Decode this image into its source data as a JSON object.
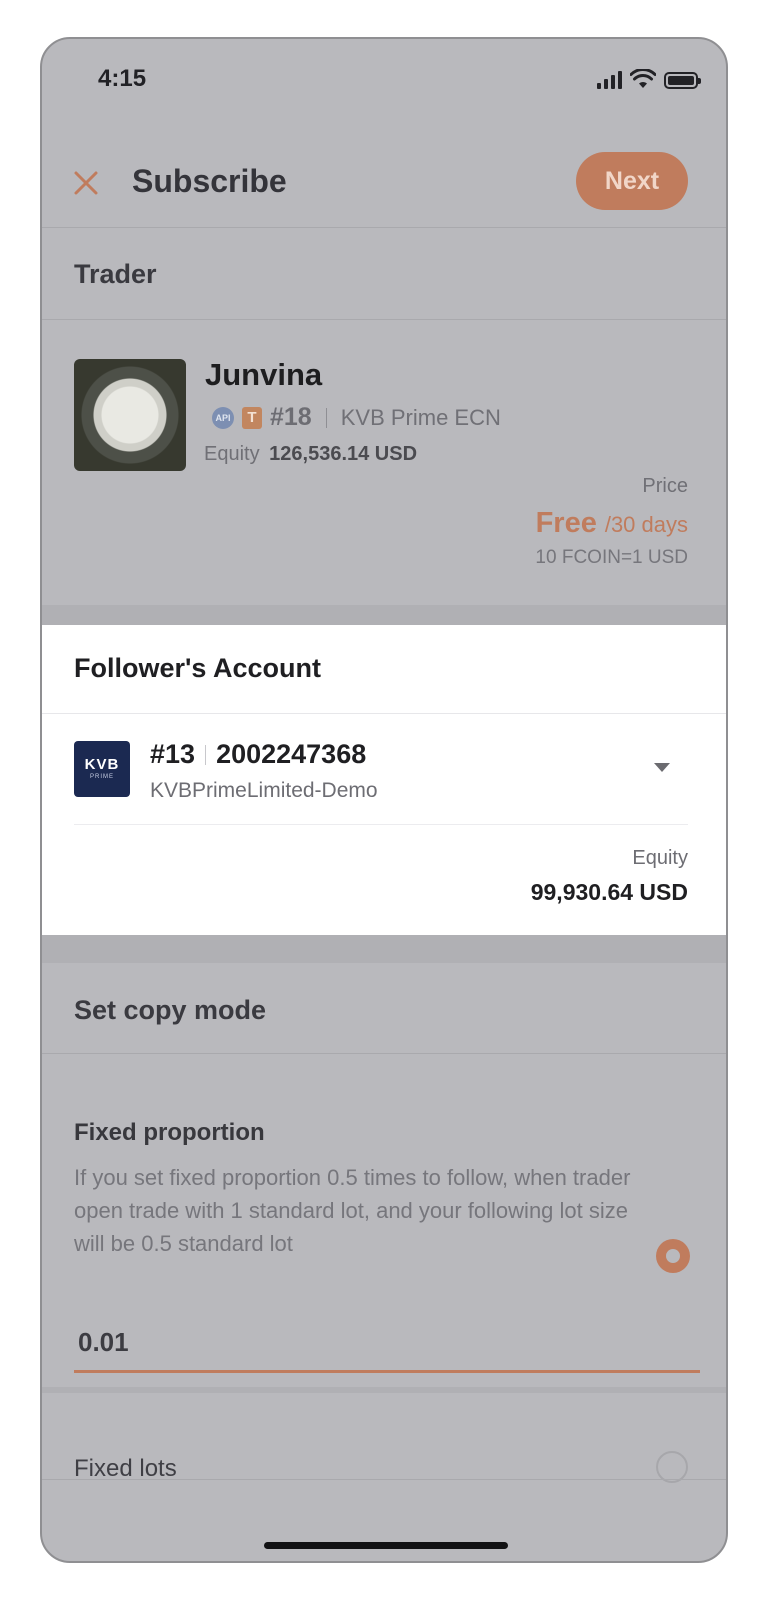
{
  "status_bar": {
    "time": "4:15"
  },
  "header": {
    "title": "Subscribe",
    "next_label": "Next"
  },
  "trader_section": {
    "title": "Trader",
    "name": "Junvina",
    "api_badge": "API",
    "t_badge": "T",
    "rank": "#18",
    "broker": "KVB Prime ECN",
    "equity_label": "Equity",
    "equity_value": "126,536.14 USD",
    "price_label": "Price",
    "price_value": "Free",
    "price_period": "/30 days",
    "coin_rate": "10 FCOIN=1 USD"
  },
  "follower_section": {
    "title": "Follower's Account",
    "logo_text": "KVB",
    "logo_subtext": "PRIME",
    "account_rank": "#13",
    "account_number": "2002247368",
    "server": "KVBPrimeLimited-Demo",
    "equity_label": "Equity",
    "equity_value": "99,930.64 USD"
  },
  "copy_mode": {
    "title": "Set copy mode",
    "fixed_proportion_title": "Fixed proportion",
    "fixed_proportion_desc": "If you set fixed proportion 0.5 times to follow, when trader open trade with 1 standard lot, and your following lot size will be 0.5 standard lot",
    "proportion_value": "0.01",
    "fixed_lots_label": "Fixed lots"
  },
  "colors": {
    "accent": "#c07c5d",
    "overlay": "#b9b9bd",
    "highlight": "#ffffff"
  }
}
